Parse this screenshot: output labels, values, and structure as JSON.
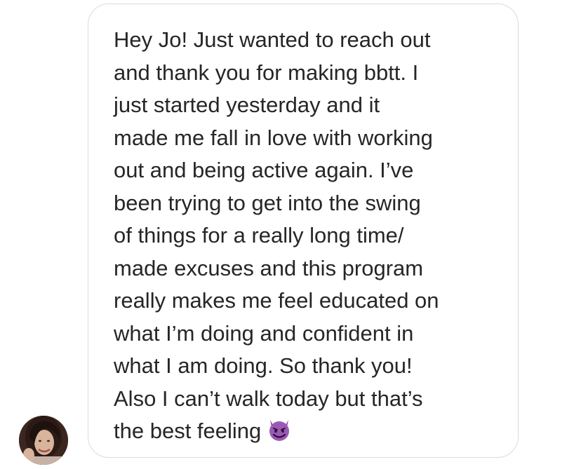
{
  "message": {
    "lines": [
      "Hey Jo! Just wanted to reach out",
      "and thank you for making bbtt. I",
      "just started yesterday and it",
      "made me fall in love with working",
      "out and being active again. I’ve",
      "been trying to get into the swing",
      "of things for a really long time/",
      "made excuses and this program",
      "really makes me feel educated on",
      "what I’m doing and confident in",
      "what I am doing. So thank you!",
      "Also I can’t walk today but that’s",
      "the best feeling"
    ],
    "emoji": "smiling-imp-emoji"
  },
  "avatar": {
    "icon": "profile-photo"
  },
  "colors": {
    "text": "#262626",
    "bubble_border": "#dbdbdb",
    "emoji_purple": "#8e44ad"
  }
}
